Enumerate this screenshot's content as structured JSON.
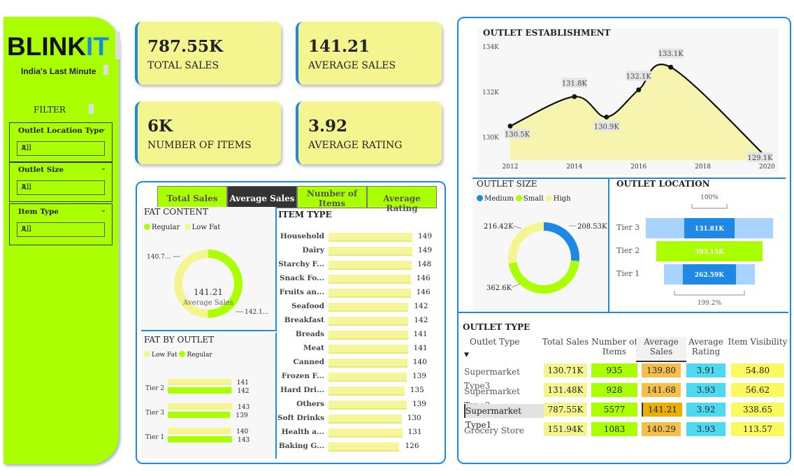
{
  "brand": {
    "name_a": "BLINK",
    "name_b": "IT",
    "tagline": "India's Last Minute"
  },
  "filters": {
    "title": "FILTER",
    "slicers": [
      {
        "label": "Outlet Location Type",
        "value": "All"
      },
      {
        "label": "Outlet Size",
        "value": "All"
      },
      {
        "label": "Item Type",
        "value": "All"
      }
    ]
  },
  "kpis": [
    {
      "value": "787.55K",
      "caption": "TOTAL SALES"
    },
    {
      "value": "141.21",
      "caption": "AVERAGE SALES"
    },
    {
      "value": "6K",
      "caption": "NUMBER OF ITEMS"
    },
    {
      "value": "3.92",
      "caption": "AVERAGE RATING"
    }
  ],
  "tabs": [
    {
      "label": "Total Sales",
      "active": false
    },
    {
      "label": "Average Sales",
      "active": true
    },
    {
      "label": "Number of Items",
      "active": false
    },
    {
      "label": "Average Rating",
      "active": false
    }
  ],
  "colors": {
    "lime": "#aaff00",
    "yellow": "#f4f58e",
    "blue": "#1e88e5",
    "cyan": "#4dd9ef",
    "orange": "#f5c04a"
  },
  "chart_data": [
    {
      "id": "fat_content",
      "type": "pie",
      "title": "FAT CONTENT",
      "legend": [
        "Regular",
        "Low Fat"
      ],
      "center_value": "141.21",
      "center_label": "Average Sales",
      "labels": [
        "140.7...",
        "142.1..."
      ],
      "values": [
        142.1,
        140.7
      ],
      "colors": [
        "#aaff00",
        "#f4f58e"
      ]
    },
    {
      "id": "item_type",
      "type": "bar",
      "title": "ITEM TYPE",
      "categories": [
        "Household",
        "Dairy",
        "Starchy F...",
        "Snack Fo...",
        "Fruits an...",
        "Seafood",
        "Breakfast",
        "Breads",
        "Meat",
        "Canned",
        "Frozen F...",
        "Hard Dri...",
        "Others",
        "Soft Drinks",
        "Health a...",
        "Baking G..."
      ],
      "values": [
        149,
        149,
        148,
        146,
        146,
        142,
        142,
        141,
        141,
        140,
        139,
        135,
        139,
        130,
        131,
        126
      ]
    },
    {
      "id": "fat_by_outlet",
      "type": "bar",
      "title": "FAT BY OUTLET",
      "legend": [
        "Low Fat",
        "Regular"
      ],
      "categories": [
        "Tier 2",
        "Tier 3",
        "Tier 1"
      ],
      "series": [
        {
          "name": "Low Fat",
          "values": [
            141,
            143,
            140
          ]
        },
        {
          "name": "Regular",
          "values": [
            142,
            139,
            143
          ]
        }
      ]
    },
    {
      "id": "outlet_establishment",
      "type": "line",
      "title": "OUTLET ESTABLISHMENT",
      "x_ticks": [
        "2012",
        "2014",
        "2016",
        "2018",
        "2020"
      ],
      "y_ticks": [
        "134K",
        "132K",
        "130K"
      ],
      "ylim": [
        129,
        134
      ],
      "x": [
        2011,
        2012,
        2013,
        2014,
        2015,
        2016,
        2017,
        2018,
        2019
      ],
      "y": [
        130.5,
        131.1,
        131.8,
        130.9,
        131.4,
        132.1,
        133.1,
        131.9,
        129.1
      ],
      "point_labels": [
        "130.5K",
        "",
        "131.8K",
        "130.9K",
        "",
        "132.1K",
        "133.1K",
        "",
        "129.1K"
      ],
      "label_x": [
        2012,
        2014,
        2015,
        2016,
        2017,
        2020
      ]
    },
    {
      "id": "outlet_size",
      "type": "pie",
      "title": "OUTLET SIZE",
      "legend": [
        "Medium",
        "Small",
        "High"
      ],
      "labels": [
        "216.42K",
        "208.53K",
        "362.6K"
      ],
      "values": [
        208.53,
        362.6,
        216.42
      ],
      "colors": [
        "#1e88e5",
        "#aaff00",
        "#f4f58e"
      ]
    },
    {
      "id": "outlet_location",
      "type": "bar",
      "title": "OUTLET LOCATION",
      "categories": [
        "Tier 3",
        "Tier 2",
        "Tier 1"
      ],
      "values": [
        131.81,
        393.15,
        262.59
      ],
      "labels": [
        "131.81K",
        "393.15K",
        "262.59K"
      ],
      "top_label": "100%",
      "bottom_label": "199.2%"
    }
  ],
  "outlet_type": {
    "title": "OUTLET TYPE",
    "headers": [
      "Outlet Type",
      "Total Sales",
      "Number of Items",
      "Average Sales",
      "Average Rating",
      "Item Visibility"
    ],
    "rows": [
      [
        "Supermarket Type3",
        "130.71K",
        "935",
        "139.80",
        "3.91",
        "54.80"
      ],
      [
        "Supermarket Type2",
        "131.48K",
        "928",
        "141.68",
        "3.93",
        "56.62"
      ],
      [
        "Supermarket Type1",
        "787.55K",
        "5577",
        "141.21",
        "3.92",
        "338.65"
      ],
      [
        "Grocery Store",
        "151.94K",
        "1083",
        "140.29",
        "3.93",
        "113.57"
      ]
    ]
  }
}
